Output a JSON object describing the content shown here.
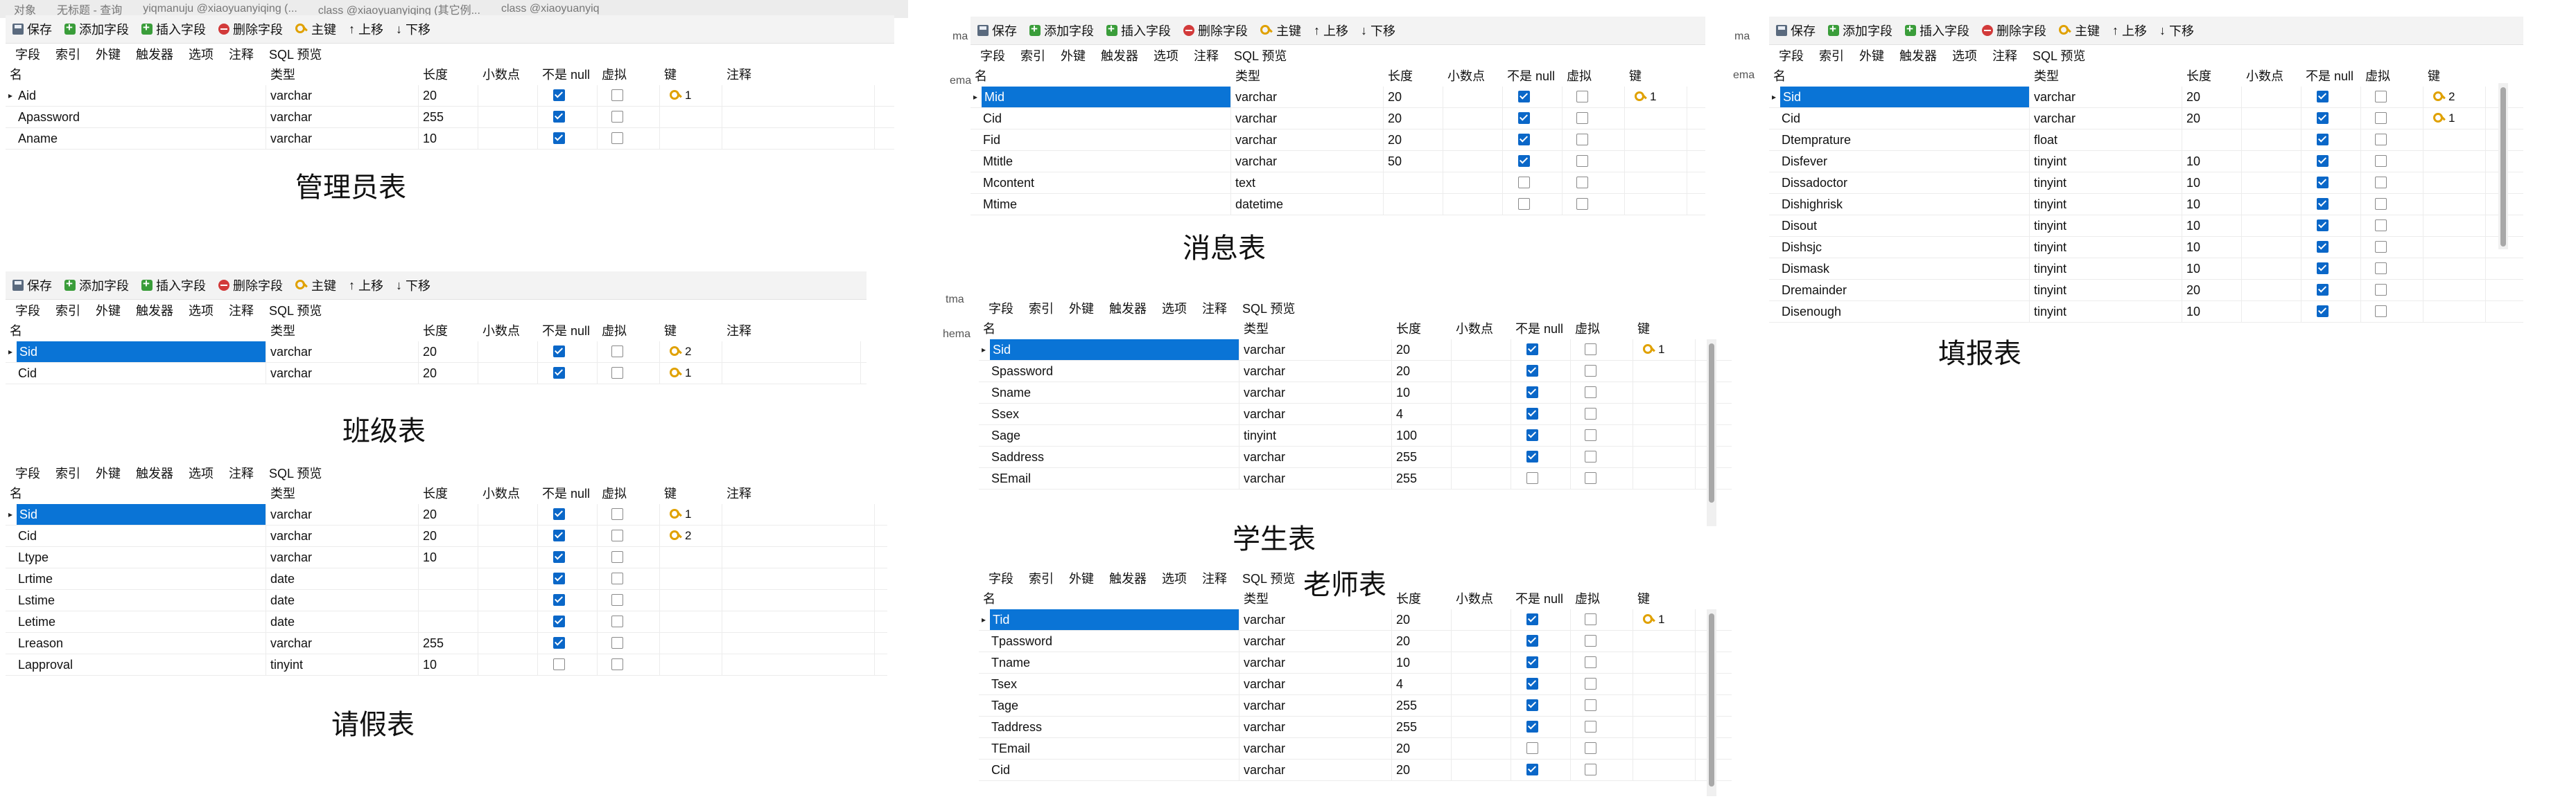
{
  "toolbar": {
    "save": "保存",
    "add_field": "添加字段",
    "insert_field": "插入字段",
    "delete_field": "删除字段",
    "primary_key": "主键",
    "move_up": "上移",
    "move_down": "下移"
  },
  "tabs": [
    "字段",
    "索引",
    "外键",
    "触发器",
    "选项",
    "注释",
    "SQL 预览"
  ],
  "columns": {
    "name": "名",
    "type": "类型",
    "length": "长度",
    "decimal": "小数点",
    "not_null": "不是 null",
    "virtual": "虚拟",
    "key": "键",
    "comment": "注释"
  },
  "top_strip": [
    "对象",
    "无标题 - 查询",
    "yiqmanuju @xiaoyuanyiqing (...",
    "class @xiaoyuanyiqing (其它例...",
    "class @xiaoyuanyiq"
  ],
  "edge_fragments": [
    "ma",
    "ema",
    "tma",
    "hema",
    "ma",
    "ema"
  ],
  "tables": [
    {
      "caption": "管理员表",
      "rows": [
        {
          "name": "Aid",
          "type": "varchar",
          "length": "20",
          "not_null": true,
          "virtual": false,
          "key": "1",
          "marker": true
        },
        {
          "name": "Apassword",
          "type": "varchar",
          "length": "255",
          "not_null": true,
          "virtual": false,
          "key": ""
        },
        {
          "name": "Aname",
          "type": "varchar",
          "length": "10",
          "not_null": true,
          "virtual": false,
          "key": ""
        }
      ]
    },
    {
      "caption": "班级表",
      "rows": [
        {
          "name": "Sid",
          "type": "varchar",
          "length": "20",
          "not_null": true,
          "virtual": false,
          "key": "2",
          "selected": true
        },
        {
          "name": "Cid",
          "type": "varchar",
          "length": "20",
          "not_null": true,
          "virtual": false,
          "key": "1"
        }
      ]
    },
    {
      "caption": "请假表",
      "rows": [
        {
          "name": "Sid",
          "type": "varchar",
          "length": "20",
          "not_null": true,
          "virtual": false,
          "key": "1",
          "selected": true
        },
        {
          "name": "Cid",
          "type": "varchar",
          "length": "20",
          "not_null": true,
          "virtual": false,
          "key": "2"
        },
        {
          "name": "Ltype",
          "type": "varchar",
          "length": "10",
          "not_null": true,
          "virtual": false,
          "key": ""
        },
        {
          "name": "Lrtime",
          "type": "date",
          "length": "",
          "not_null": true,
          "virtual": false,
          "key": ""
        },
        {
          "name": "Lstime",
          "type": "date",
          "length": "",
          "not_null": true,
          "virtual": false,
          "key": ""
        },
        {
          "name": "Letime",
          "type": "date",
          "length": "",
          "not_null": true,
          "virtual": false,
          "key": ""
        },
        {
          "name": "Lreason",
          "type": "varchar",
          "length": "255",
          "not_null": true,
          "virtual": false,
          "key": ""
        },
        {
          "name": "Lapproval",
          "type": "tinyint",
          "length": "10",
          "not_null": false,
          "virtual": false,
          "key": ""
        }
      ]
    },
    {
      "caption": "消息表",
      "rows": [
        {
          "name": "Mid",
          "type": "varchar",
          "length": "20",
          "not_null": true,
          "virtual": false,
          "key": "1",
          "selected": true
        },
        {
          "name": "Cid",
          "type": "varchar",
          "length": "20",
          "not_null": true,
          "virtual": false,
          "key": ""
        },
        {
          "name": "Fid",
          "type": "varchar",
          "length": "20",
          "not_null": true,
          "virtual": false,
          "key": ""
        },
        {
          "name": "Mtitle",
          "type": "varchar",
          "length": "50",
          "not_null": true,
          "virtual": false,
          "key": ""
        },
        {
          "name": "Mcontent",
          "type": "text",
          "length": "",
          "not_null": false,
          "virtual": false,
          "key": ""
        },
        {
          "name": "Mtime",
          "type": "datetime",
          "length": "",
          "not_null": false,
          "virtual": false,
          "key": ""
        }
      ]
    },
    {
      "caption": "学生表",
      "rows": [
        {
          "name": "Sid",
          "type": "varchar",
          "length": "20",
          "not_null": true,
          "virtual": false,
          "key": "1",
          "selected": true
        },
        {
          "name": "Spassword",
          "type": "varchar",
          "length": "20",
          "not_null": true,
          "virtual": false,
          "key": ""
        },
        {
          "name": "Sname",
          "type": "varchar",
          "length": "10",
          "not_null": true,
          "virtual": false,
          "key": ""
        },
        {
          "name": "Ssex",
          "type": "varchar",
          "length": "4",
          "not_null": true,
          "virtual": false,
          "key": ""
        },
        {
          "name": "Sage",
          "type": "tinyint",
          "length": "100",
          "not_null": true,
          "virtual": false,
          "key": ""
        },
        {
          "name": "Saddress",
          "type": "varchar",
          "length": "255",
          "not_null": true,
          "virtual": false,
          "key": ""
        },
        {
          "name": "SEmail",
          "type": "varchar",
          "length": "255",
          "not_null": false,
          "virtual": false,
          "key": ""
        }
      ]
    },
    {
      "caption": "老师表",
      "rows": [
        {
          "name": "Tid",
          "type": "varchar",
          "length": "20",
          "not_null": true,
          "virtual": false,
          "key": "1",
          "selected": true
        },
        {
          "name": "Tpassword",
          "type": "varchar",
          "length": "20",
          "not_null": true,
          "virtual": false,
          "key": ""
        },
        {
          "name": "Tname",
          "type": "varchar",
          "length": "10",
          "not_null": true,
          "virtual": false,
          "key": ""
        },
        {
          "name": "Tsex",
          "type": "varchar",
          "length": "4",
          "not_null": true,
          "virtual": false,
          "key": ""
        },
        {
          "name": "Tage",
          "type": "varchar",
          "length": "255",
          "not_null": true,
          "virtual": false,
          "key": ""
        },
        {
          "name": "Taddress",
          "type": "varchar",
          "length": "255",
          "not_null": true,
          "virtual": false,
          "key": ""
        },
        {
          "name": "TEmail",
          "type": "varchar",
          "length": "20",
          "not_null": false,
          "virtual": false,
          "key": ""
        },
        {
          "name": "Cid",
          "type": "varchar",
          "length": "20",
          "not_null": true,
          "virtual": false,
          "key": ""
        }
      ]
    },
    {
      "caption": "填报表",
      "rows": [
        {
          "name": "Sid",
          "type": "varchar",
          "length": "20",
          "not_null": true,
          "virtual": false,
          "key": "2",
          "selected": true
        },
        {
          "name": "Cid",
          "type": "varchar",
          "length": "20",
          "not_null": true,
          "virtual": false,
          "key": "1"
        },
        {
          "name": "Dtemprature",
          "type": "float",
          "length": "",
          "not_null": true,
          "virtual": false,
          "key": ""
        },
        {
          "name": "Disfever",
          "type": "tinyint",
          "length": "10",
          "not_null": true,
          "virtual": false,
          "key": ""
        },
        {
          "name": "Dissadoctor",
          "type": "tinyint",
          "length": "10",
          "not_null": true,
          "virtual": false,
          "key": ""
        },
        {
          "name": "Dishighrisk",
          "type": "tinyint",
          "length": "10",
          "not_null": true,
          "virtual": false,
          "key": ""
        },
        {
          "name": "Disout",
          "type": "tinyint",
          "length": "10",
          "not_null": true,
          "virtual": false,
          "key": ""
        },
        {
          "name": "Dishsjc",
          "type": "tinyint",
          "length": "10",
          "not_null": true,
          "virtual": false,
          "key": ""
        },
        {
          "name": "Dismask",
          "type": "tinyint",
          "length": "10",
          "not_null": true,
          "virtual": false,
          "key": ""
        },
        {
          "name": "Dremainder",
          "type": "tinyint",
          "length": "20",
          "not_null": true,
          "virtual": false,
          "key": ""
        },
        {
          "name": "Disenough",
          "type": "tinyint",
          "length": "10",
          "not_null": true,
          "virtual": false,
          "key": ""
        }
      ]
    }
  ]
}
